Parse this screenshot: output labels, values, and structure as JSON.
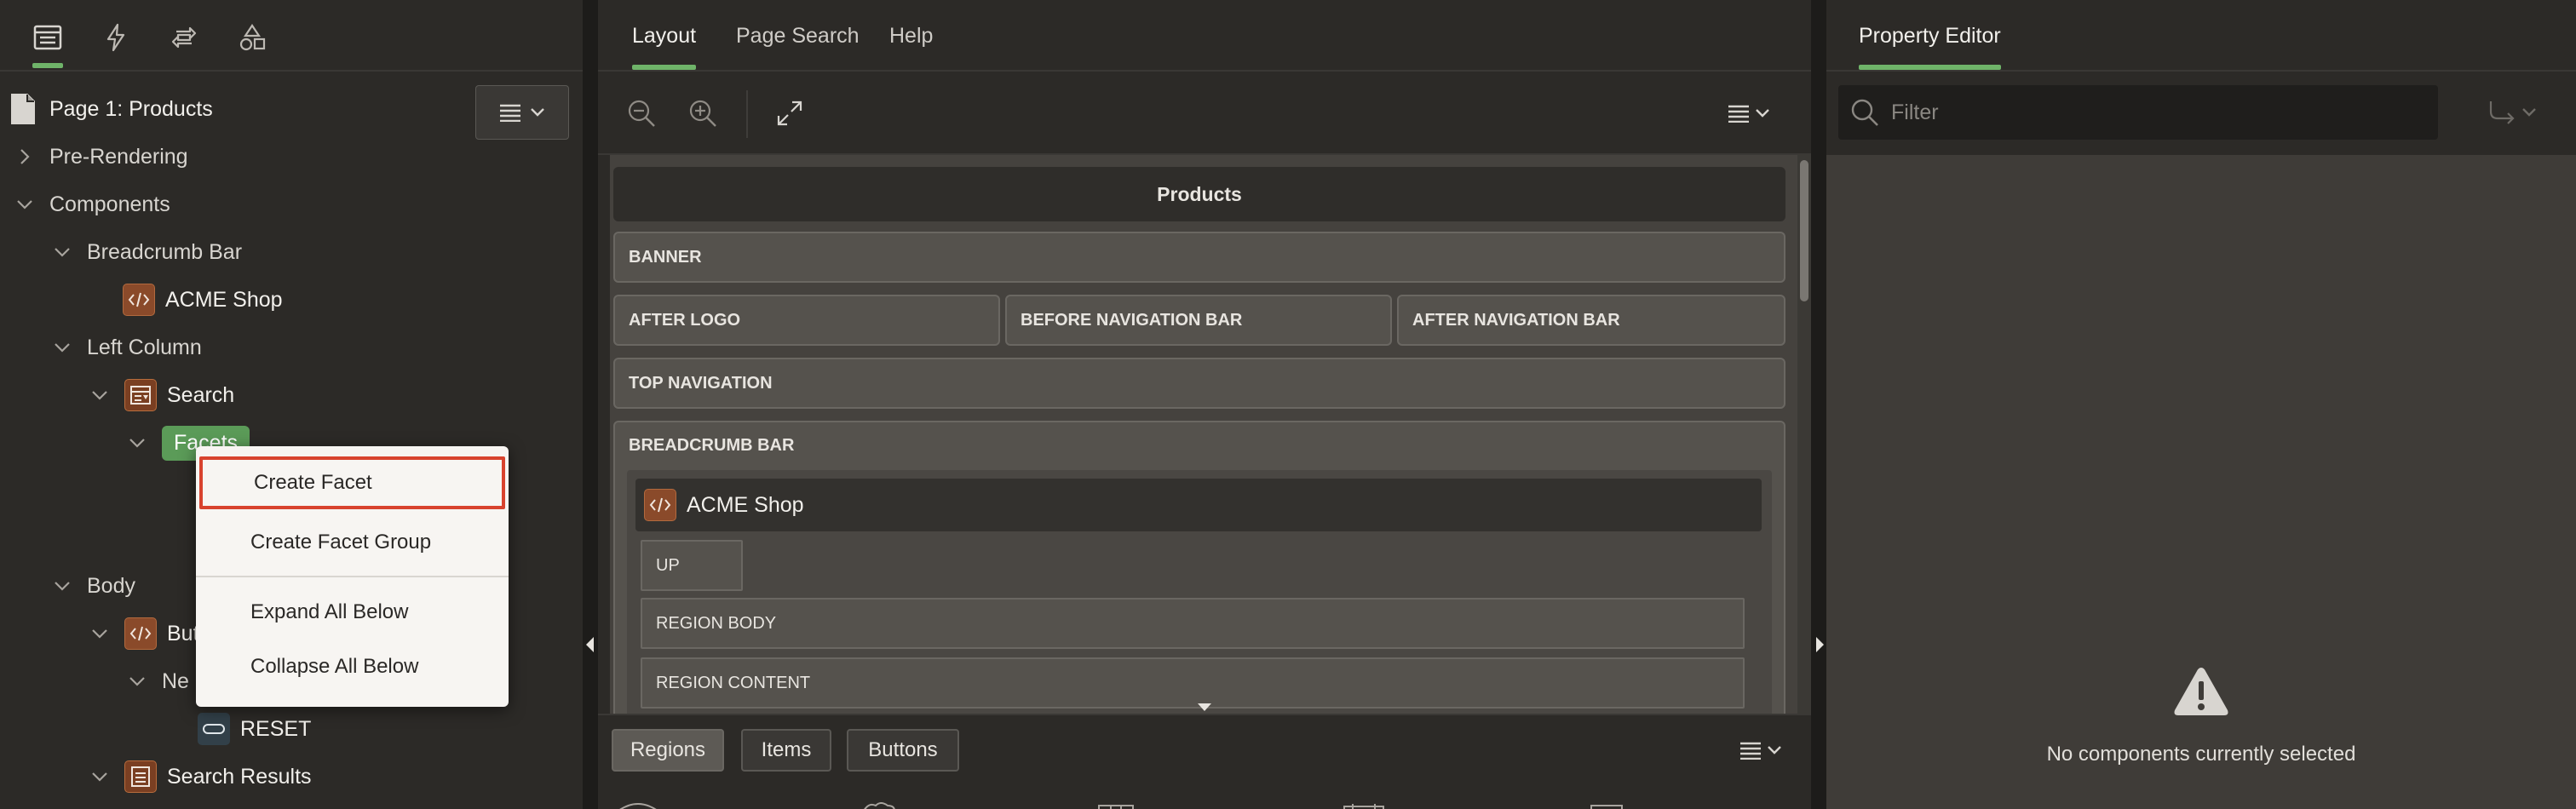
{
  "left": {
    "page_title": "Page 1: Products",
    "tree": {
      "pre_rendering": "Pre-Rendering",
      "components": "Components",
      "breadcrumb_bar": "Breadcrumb Bar",
      "acme_shop": "ACME Shop",
      "left_column": "Left Column",
      "search": "Search",
      "facets": "Facets",
      "body": "Body",
      "buttons_partial": "Butt",
      "new_partial": "Ne",
      "reset": "RESET",
      "search_results": "Search Results"
    }
  },
  "context_menu": {
    "items": [
      "Create Facet",
      "Create Facet Group",
      "Expand All Below",
      "Collapse All Below"
    ]
  },
  "middle": {
    "tabs": [
      "Layout",
      "Page Search",
      "Help"
    ],
    "canvas": {
      "page_name": "Products",
      "banner": "BANNER",
      "after_logo": "AFTER LOGO",
      "before_nav": "BEFORE NAVIGATION BAR",
      "after_nav": "AFTER NAVIGATION BAR",
      "top_nav": "TOP NAVIGATION",
      "breadcrumb_bar": "BREADCRUMB BAR",
      "acme_shop": "ACME Shop",
      "up": "UP",
      "region_body": "REGION BODY",
      "region_content": "REGION CONTENT"
    },
    "bottom_tabs": [
      "Regions",
      "Items",
      "Buttons"
    ]
  },
  "right": {
    "title": "Property Editor",
    "filter_placeholder": "Filter",
    "empty_message": "No components currently selected"
  },
  "colors": {
    "accent_green": "#6fb469",
    "highlight_red": "#d8432e"
  }
}
